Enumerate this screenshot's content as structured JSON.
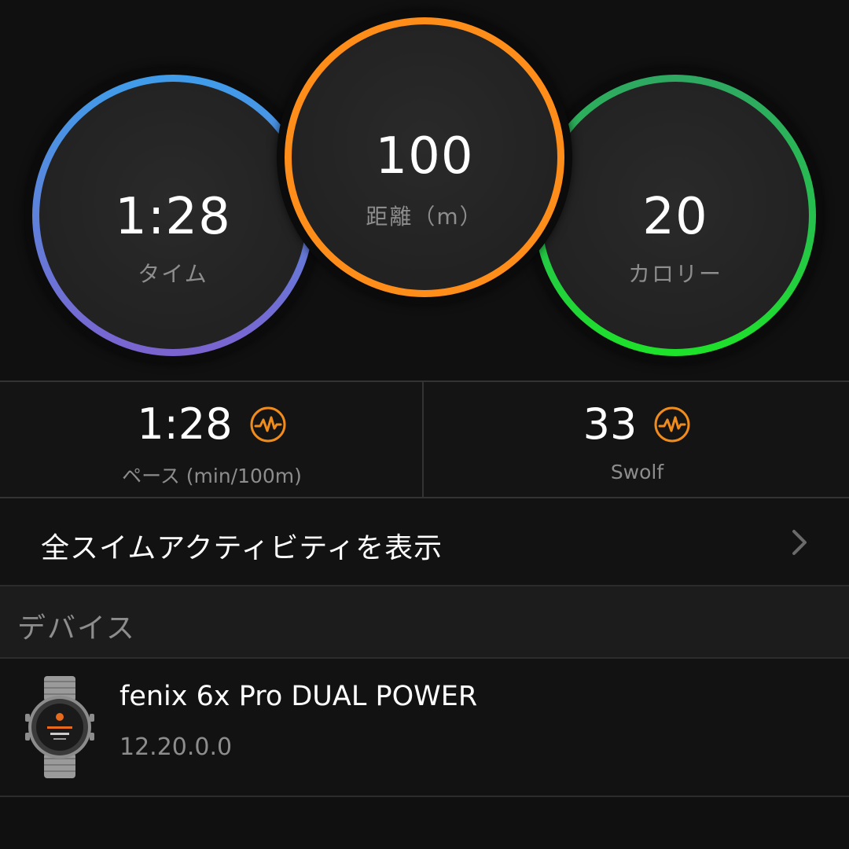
{
  "summary": {
    "time": {
      "value": "1:28",
      "label": "タイム"
    },
    "distance": {
      "value": "100",
      "label": "距離（m）"
    },
    "calories": {
      "value": "20",
      "label": "カロリー"
    }
  },
  "stats": {
    "pace": {
      "value": "1:28",
      "label": "ペース (min/100m)",
      "icon": "pulse-icon"
    },
    "swolf": {
      "value": "33",
      "label": "Swolf",
      "icon": "pulse-icon"
    }
  },
  "link": {
    "label": "全スイムアクティビティを表示",
    "icon": "chevron-right-icon"
  },
  "devices": {
    "section_title": "デバイス",
    "items": [
      {
        "name": "fenix 6x Pro DUAL POWER",
        "version": "12.20.0.0",
        "icon": "watch-icon"
      }
    ]
  },
  "colors": {
    "time_ring": "#3f9dea",
    "time_ring_end": "#7b63d0",
    "distance_ring": "#ff8d1a",
    "calories_ring": "#1ee22a",
    "accent_icon": "#f08c1c",
    "background": "#101010"
  }
}
